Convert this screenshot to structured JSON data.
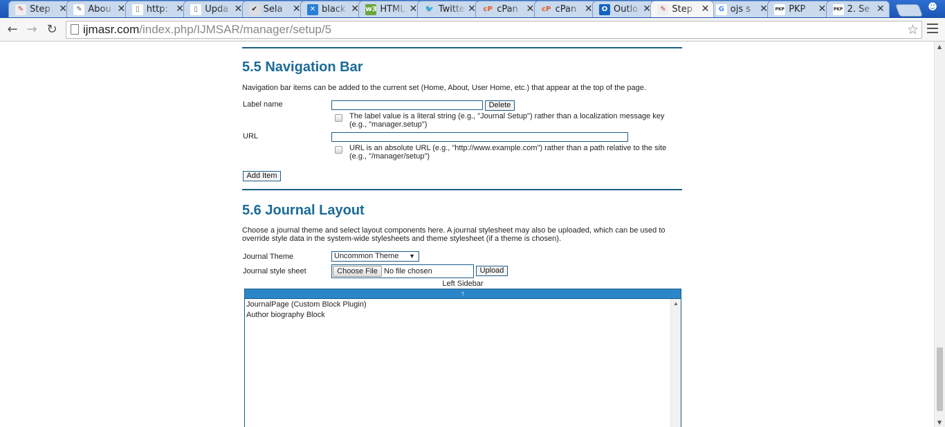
{
  "browser": {
    "tabs": [
      {
        "label": "Step",
        "icon": "ojs-icon",
        "active": false
      },
      {
        "label": "Abou",
        "icon": "page-edit-icon",
        "active": false
      },
      {
        "label": "http:",
        "icon": "document-icon",
        "active": false
      },
      {
        "label": "Upda",
        "icon": "document-icon",
        "active": false
      },
      {
        "label": "Sela",
        "icon": "selenium-icon",
        "active": false
      },
      {
        "label": "black",
        "icon": "x-logo-icon",
        "active": false
      },
      {
        "label": "HTML",
        "icon": "w3-icon",
        "active": false
      },
      {
        "label": "Twitte",
        "icon": "twitter-icon",
        "active": false
      },
      {
        "label": "cPan",
        "icon": "cpanel-icon",
        "active": false
      },
      {
        "label": "cPan",
        "icon": "cpanel-icon",
        "active": false
      },
      {
        "label": "Outlo",
        "icon": "outlook-icon",
        "active": false
      },
      {
        "label": "Step",
        "icon": "ojs-icon",
        "active": true
      },
      {
        "label": "ojs s",
        "icon": "google-icon",
        "active": false
      },
      {
        "label": "PKP",
        "icon": "pkp-icon",
        "active": false
      },
      {
        "label": "2. Se",
        "icon": "pkp-icon",
        "active": false
      }
    ],
    "url_host": "ijmasr.com",
    "url_path": "/index.php/IJMSAR/manager/setup/5"
  },
  "section_nav": {
    "title": "5.5 Navigation Bar",
    "description": "Navigation bar items can be added to the current set (Home, About, User Home, etc.) that appear at the top of the page.",
    "label_name_label": "Label name",
    "label_name_value": "",
    "delete_label": "Delete",
    "label_checkbox_text": "The label value is a literal string (e.g., \"Journal Setup\") rather than a localization message key (e.g., \"manager.setup\")",
    "url_label": "URL",
    "url_value": "",
    "url_checkbox_text": "URL is an absolute URL (e.g., \"http://www.example.com\") rather than a path relative to the site (e.g., \"/manager/setup\")",
    "add_item_label": "Add Item"
  },
  "section_layout": {
    "title": "5.6 Journal Layout",
    "description": "Choose a journal theme and select layout components here. A journal stylesheet may also be uploaded, which can be used to override style data in the system-wide stylesheets and theme stylesheet (if a theme is chosen).",
    "theme_label": "Journal Theme",
    "theme_value": "Uncommon Theme",
    "stylesheet_label": "Journal style sheet",
    "choose_file_label": "Choose File",
    "file_status": "No file chosen",
    "upload_label": "Upload",
    "left_sidebar_title": "Left Sidebar",
    "sidebar_move_glyph": "↑",
    "sidebar_items": [
      "JournalPage (Custom Block Plugin)",
      "Author biography Block"
    ]
  }
}
